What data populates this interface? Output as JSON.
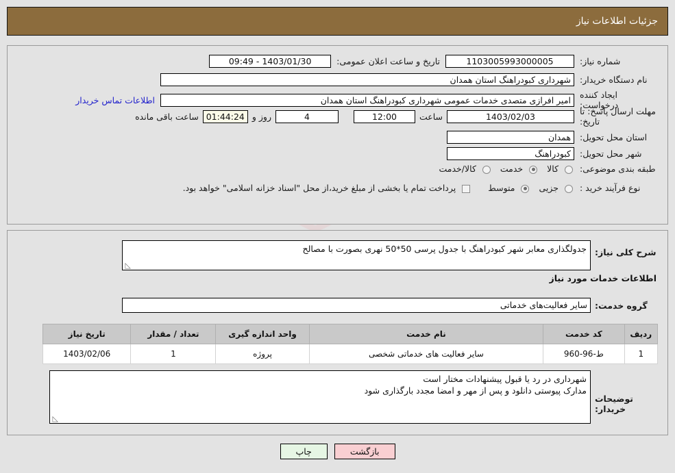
{
  "header": {
    "title": "جزئیات اطلاعات نیاز"
  },
  "form": {
    "need_number_label": "شماره نیاز:",
    "need_number_value": "1103005993000005",
    "announce_label": "تاریخ و ساعت اعلان عمومی:",
    "announce_value": "1403/01/30 - 09:49",
    "buyer_org_label": "نام دستگاه خریدار:",
    "buyer_org_value": "شهرداری کبودراهنگ استان همدان",
    "requester_label": "ایجاد کننده درخواست:",
    "requester_value": "امیر افرازی متصدی خدمات عمومی شهرداری کبودراهنگ استان همدان",
    "contact_link": "اطلاعات تماس خریدار",
    "deadline_label": "مهلت ارسال پاسخ: تا تاریخ:",
    "deadline_date": "1403/02/03",
    "hour_label": "ساعت",
    "deadline_time": "12:00",
    "days_remaining": "4",
    "days_label": "روز و",
    "countdown": "01:44:24",
    "countdown_label": "ساعت باقی مانده",
    "province_label": "استان محل تحویل:",
    "province_value": "همدان",
    "city_label": "شهر محل تحویل:",
    "city_value": "کبودراهنگ",
    "category_label": "طبقه بندی موضوعی:",
    "category_options": [
      {
        "label": "کالا",
        "selected": false
      },
      {
        "label": "خدمت",
        "selected": true
      },
      {
        "label": "کالا/خدمت",
        "selected": false
      }
    ],
    "process_label": "نوع فرآیند خرید :",
    "process_options": [
      {
        "label": "جزیی",
        "selected": false
      },
      {
        "label": "متوسط",
        "selected": true
      }
    ],
    "treasury_checkbox_checked": false,
    "treasury_note": "پرداخت تمام یا بخشی از مبلغ خرید،از محل \"اسناد خزانه اسلامی\" خواهد بود."
  },
  "description": {
    "need_summary_label": "شرح کلی نیاز:",
    "need_summary_value": "جدولگذاری معابر شهر کبودراهنگ با جدول پرسی 50*50 نهری بصورت با مصالح",
    "services_section_title": "اطلاعات خدمات مورد نیاز",
    "service_group_label": "گروه خدمت:",
    "service_group_value": "سایر فعالیت‌های خدماتی"
  },
  "items_table": {
    "columns": [
      "ردیف",
      "کد خدمت",
      "نام خدمت",
      "واحد اندازه گیری",
      "تعداد / مقدار",
      "تاریخ نیاز"
    ],
    "rows": [
      {
        "row": "1",
        "code": "ط-96-960",
        "name": "سایر فعالیت های خدماتی شخصی",
        "unit": "پروژه",
        "qty": "1",
        "date": "1403/02/06"
      }
    ]
  },
  "buyer_notes": {
    "label": "توضیحات خریدار:",
    "line1": "شهرداری در رد یا قبول پیشنهادات مختار است",
    "line2": "مدارک پیوستی دانلود و پس از مهر و امضا مجدد بارگذاری شود"
  },
  "buttons": {
    "back": "بازگشت",
    "print": "چاپ"
  },
  "watermark": {
    "text": "AriaTender.net"
  },
  "colors": {
    "header_bar": "#8c6c3d",
    "link": "#2222cc",
    "table_header": "#c9c9c9",
    "btn_back": "#f9cfd2",
    "btn_print": "#e6f6e4",
    "page_bg": "#e3e3e3"
  }
}
